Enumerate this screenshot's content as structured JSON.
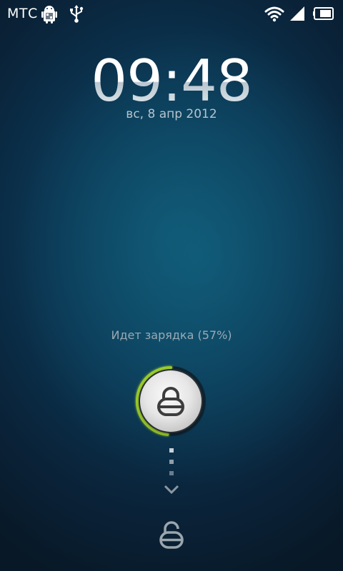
{
  "status_bar": {
    "carrier": "МТС",
    "icons": [
      "android-debug-icon",
      "usb-icon",
      "wifi-icon",
      "signal-icon",
      "battery-icon"
    ]
  },
  "lockscreen": {
    "time": "09:48",
    "date": "вс, 8 апр 2012",
    "charging_text": "Идет зарядка (57%)",
    "charge_level_percent": 57,
    "accent_color": "#9ccc2a"
  }
}
